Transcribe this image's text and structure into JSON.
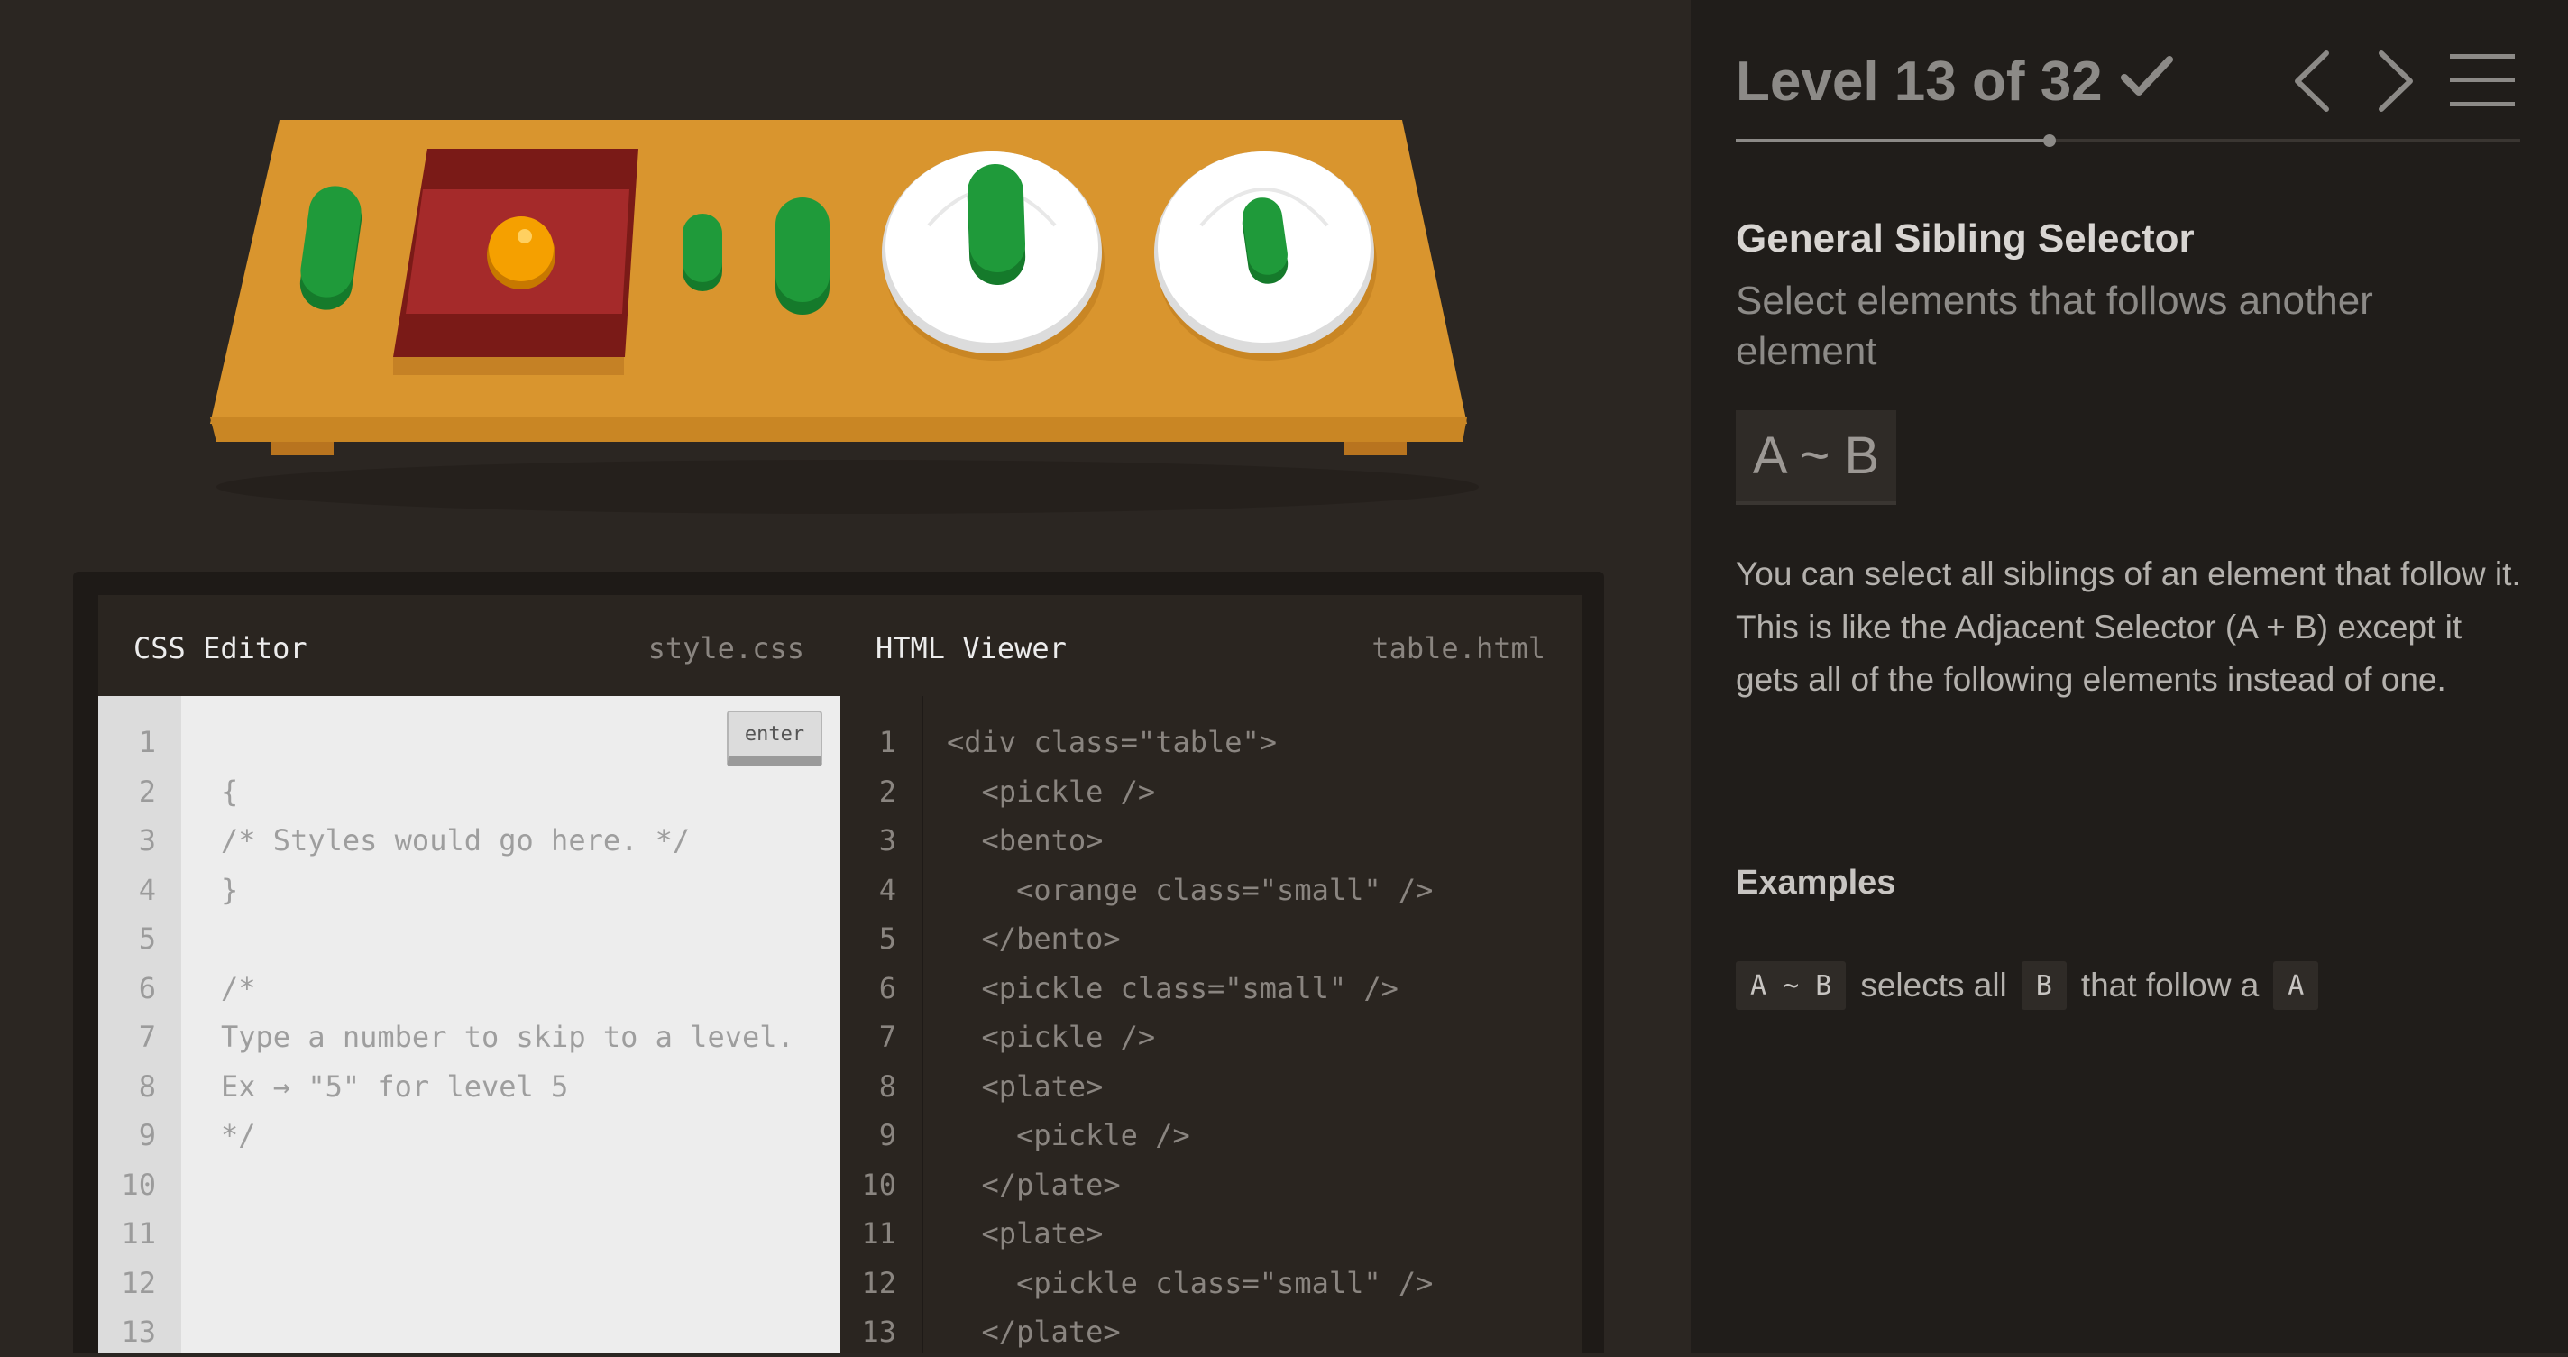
{
  "level": {
    "title": "Level 13 of 32",
    "current": 13,
    "total": 32,
    "completed": true,
    "progress_fraction": 0.4
  },
  "nav": {
    "prev_icon": "chevron-left-icon",
    "next_icon": "chevron-right-icon",
    "menu_icon": "hamburger-menu-icon"
  },
  "lesson": {
    "name": "General Sibling Selector",
    "description": "Select elements that follows another element",
    "syntax": "A ~ B",
    "help": "You can select all siblings of an element that follow it. This is like the Adjacent Selector (A + B) except it gets all of the following elements instead of one.",
    "examples_title": "Examples",
    "example": {
      "selector": "A ~ B",
      "text1": "selects all",
      "tag1": "B",
      "text2": "that follow a",
      "tag2": "A"
    }
  },
  "css_editor": {
    "title": "CSS Editor",
    "file": "style.css",
    "enter_label": "enter",
    "input_value": "",
    "line_numbers": [
      "1",
      "2",
      "3",
      "4",
      "5",
      "6",
      "7",
      "8",
      "9",
      "10",
      "11",
      "12",
      "13"
    ],
    "lines": [
      "",
      "{",
      "/* Styles would go here. */",
      "}",
      "",
      "/*",
      "Type a number to skip to a level.",
      "Ex → \"5\" for level 5",
      "*/",
      "",
      "",
      "",
      ""
    ]
  },
  "html_viewer": {
    "title": "HTML Viewer",
    "file": "table.html",
    "line_numbers": [
      "1",
      "2",
      "3",
      "4",
      "5",
      "6",
      "7",
      "8",
      "9",
      "10",
      "11",
      "12",
      "13"
    ],
    "lines": [
      "<div class=\"table\">",
      "  <pickle />",
      "  <bento>",
      "    <orange class=\"small\" />",
      "  </bento>",
      "  <pickle class=\"small\" />",
      "  <pickle />",
      "  <plate>",
      "    <pickle />",
      "  </plate>",
      "  <plate>",
      "    <pickle class=\"small\" />",
      "  </plate>"
    ]
  },
  "colors": {
    "background": "#2b2622",
    "sidebar": "#201d1a",
    "table_wood": "#d9952e",
    "bento_red": "#a52a2a",
    "pickle_green": "#1f9a3a",
    "orange": "#f5a000",
    "plate_white": "#ffffff"
  }
}
